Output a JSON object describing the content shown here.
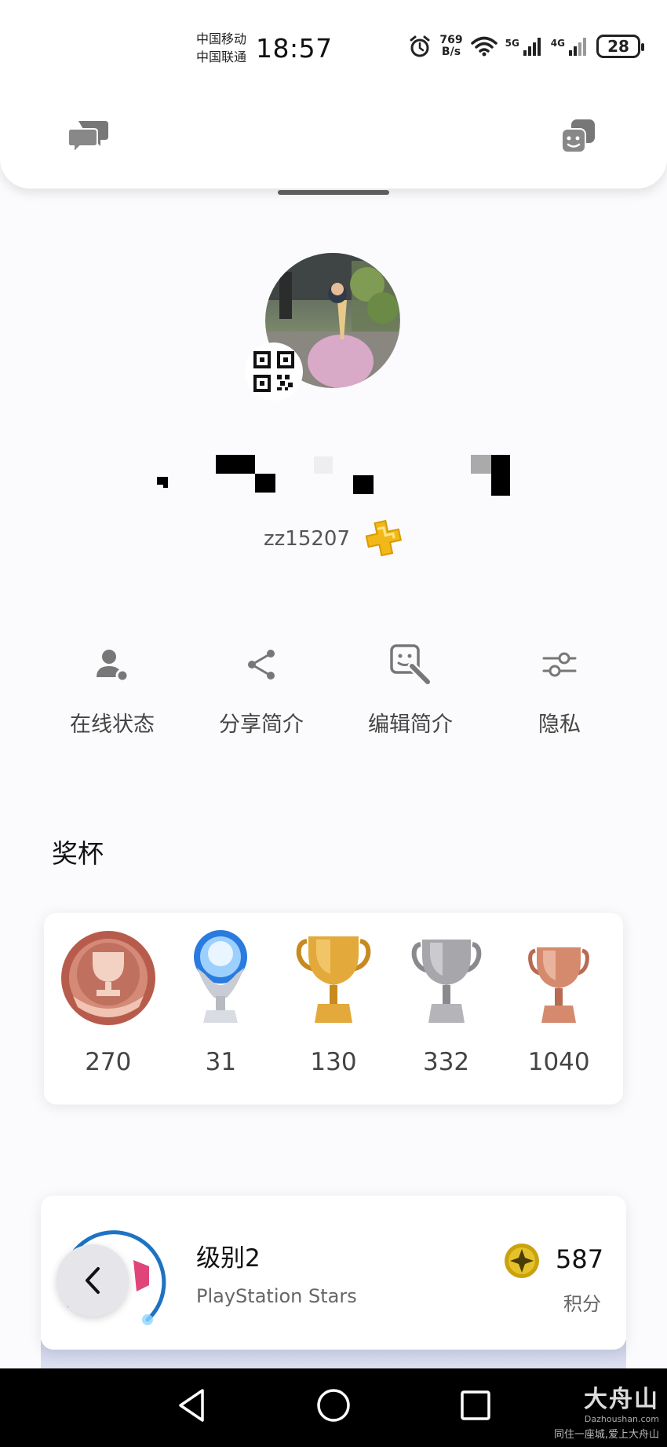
{
  "status_bar": {
    "carrier_1": "中国移动",
    "carrier_2": "中国联通",
    "time": "18:57",
    "net_speed_value": "769",
    "net_speed_unit": "B/s",
    "signal_1_label": "5G",
    "signal_2_label": "4G",
    "battery": "28",
    "icons": [
      "alarm-icon",
      "wifi-icon",
      "signal-icon",
      "battery-icon"
    ]
  },
  "header": {
    "left_icon": "messages-icon",
    "right_icon": "game-lists-icon"
  },
  "profile": {
    "online_id": "zz15207",
    "plus_badge": "playstation-plus-icon"
  },
  "actions": [
    {
      "label": "在线状态",
      "icon": "online-status-icon"
    },
    {
      "label": "分享简介",
      "icon": "share-icon"
    },
    {
      "label": "编辑简介",
      "icon": "edit-profile-icon"
    },
    {
      "label": "隐私",
      "icon": "privacy-settings-icon"
    }
  ],
  "trophies": {
    "title": "奖杯",
    "items": [
      {
        "type": "level",
        "count": "270"
      },
      {
        "type": "platinum",
        "count": "31"
      },
      {
        "type": "gold",
        "count": "130"
      },
      {
        "type": "silver",
        "count": "332"
      },
      {
        "type": "bronze",
        "count": "1040"
      }
    ]
  },
  "stars": {
    "level": "级别2",
    "program": "PlayStation Stars",
    "points": "587",
    "points_label": "积分"
  },
  "watermark": {
    "name": "大舟山",
    "site": "Dazhoushan.com",
    "tagline": "同住一座城,爱上大舟山"
  },
  "colors": {
    "background": "#fbfbfd",
    "gold": "#d9a53a",
    "silver": "#b8b8bc",
    "bronze": "#d58a6e",
    "level_badge": "#c0705f",
    "ring_blue": "#1d72c4"
  }
}
